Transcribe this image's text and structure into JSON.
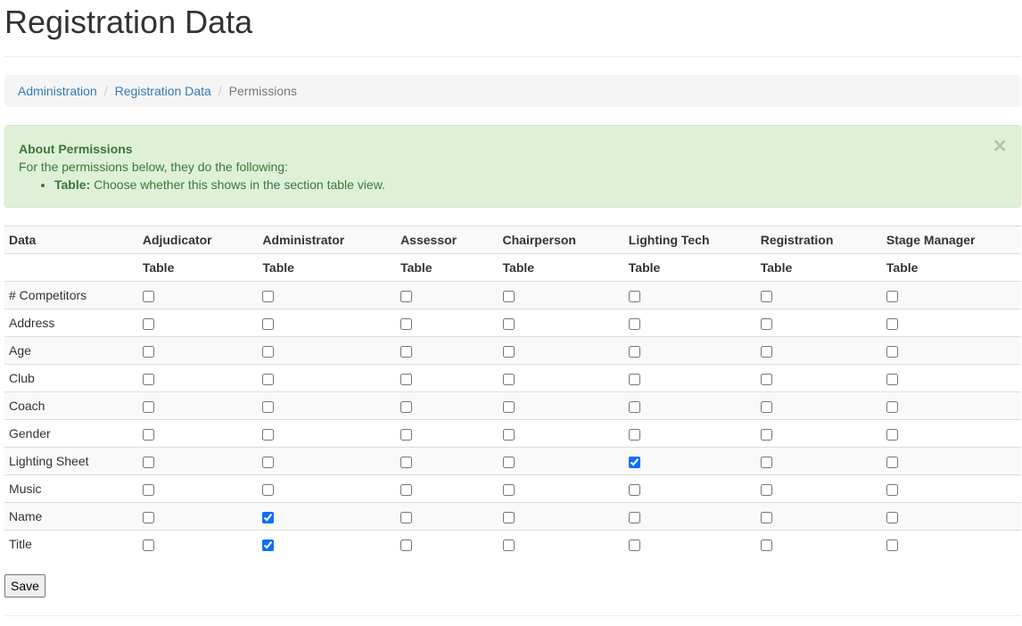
{
  "header": {
    "title": "Registration Data"
  },
  "breadcrumb": [
    {
      "label": "Administration",
      "link": true
    },
    {
      "label": "Registration Data",
      "link": true
    },
    {
      "label": "Permissions",
      "link": false
    }
  ],
  "alert": {
    "heading": "About Permissions",
    "intro": "For the permissions below, they do the following:",
    "items": [
      {
        "term": "Table:",
        "description": "Choose whether this shows in the section table view."
      }
    ],
    "close_icon": "×"
  },
  "table": {
    "first_header": "Data",
    "sub_header": "Table",
    "roles": [
      "Adjudicator",
      "Administrator",
      "Assessor",
      "Chairperson",
      "Lighting Tech",
      "Registration",
      "Stage Manager"
    ],
    "rows": [
      {
        "label": "# Competitors",
        "checked": [
          false,
          false,
          false,
          false,
          false,
          false,
          false
        ]
      },
      {
        "label": "Address",
        "checked": [
          false,
          false,
          false,
          false,
          false,
          false,
          false
        ]
      },
      {
        "label": "Age",
        "checked": [
          false,
          false,
          false,
          false,
          false,
          false,
          false
        ]
      },
      {
        "label": "Club",
        "checked": [
          false,
          false,
          false,
          false,
          false,
          false,
          false
        ]
      },
      {
        "label": "Coach",
        "checked": [
          false,
          false,
          false,
          false,
          false,
          false,
          false
        ]
      },
      {
        "label": "Gender",
        "checked": [
          false,
          false,
          false,
          false,
          false,
          false,
          false
        ]
      },
      {
        "label": "Lighting Sheet",
        "checked": [
          false,
          false,
          false,
          false,
          true,
          false,
          false
        ]
      },
      {
        "label": "Music",
        "checked": [
          false,
          false,
          false,
          false,
          false,
          false,
          false
        ]
      },
      {
        "label": "Name",
        "checked": [
          false,
          true,
          false,
          false,
          false,
          false,
          false
        ]
      },
      {
        "label": "Title",
        "checked": [
          false,
          true,
          false,
          false,
          false,
          false,
          false
        ]
      }
    ]
  },
  "save_label": "Save"
}
